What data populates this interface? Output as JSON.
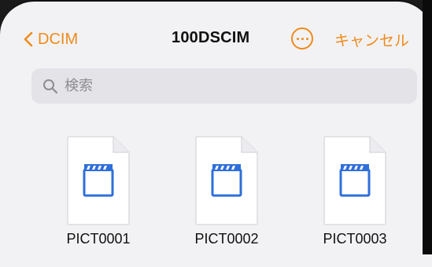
{
  "nav": {
    "back_label": "DCIM",
    "title": "100DSCIM",
    "cancel_label": "キャンセル"
  },
  "search": {
    "placeholder": "検索"
  },
  "files": [
    {
      "name": "PICT0001",
      "icon": "video-file-icon"
    },
    {
      "name": "PICT0002",
      "icon": "video-file-icon"
    },
    {
      "name": "PICT0003",
      "icon": "video-file-icon"
    }
  ],
  "colors": {
    "accent": "#ef8a1a",
    "background": "#f2f2f4",
    "search_field": "#e3e3e8",
    "clapper_blue": "#2f6fdb"
  }
}
